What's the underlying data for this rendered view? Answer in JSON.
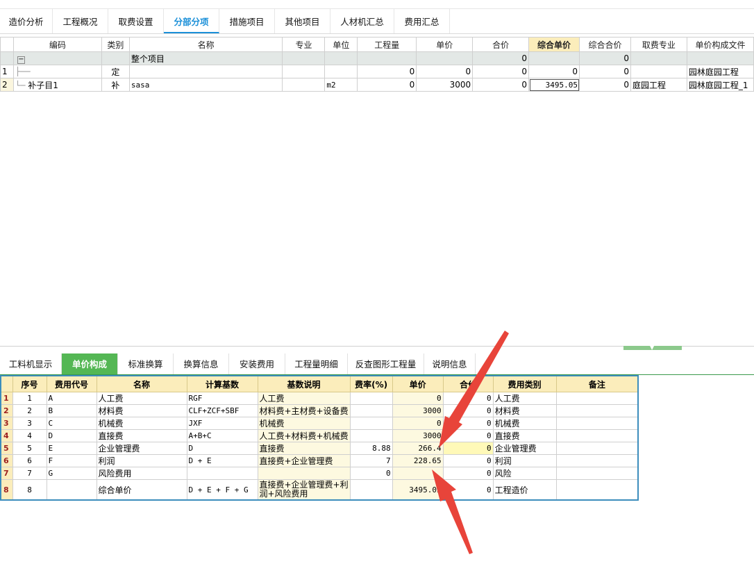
{
  "top_tabs": [
    "造价分析",
    "工程概况",
    "取费设置",
    "分部分项",
    "措施项目",
    "其他项目",
    "人材机汇总",
    "费用汇总"
  ],
  "active_top_tab": "分部分项",
  "main_grid": {
    "headers": [
      "编码",
      "类别",
      "名称",
      "专业",
      "单位",
      "工程量",
      "单价",
      "合价",
      "综合单价",
      "综合合价",
      "取费专业",
      "单价构成文件"
    ],
    "group_row": {
      "name": "整个项目",
      "total": "0",
      "composite_total": "0"
    },
    "rows": [
      {
        "row_no": "1",
        "code": "",
        "type": "定",
        "name": "",
        "major": "",
        "unit": "",
        "qty": "0",
        "price": "0",
        "total": "0",
        "comp_price": "0",
        "comp_total": "0",
        "fee_major": "",
        "file": "园林庭园工程"
      },
      {
        "row_no": "2",
        "code": "补子目1",
        "type": "补",
        "name": "sasa",
        "major": "",
        "unit": "m2",
        "qty": "0",
        "price": "3000",
        "total": "0",
        "comp_price": "3495.05",
        "comp_total": "0",
        "fee_major": "庭园工程",
        "file": "园林庭园工程_1"
      }
    ]
  },
  "bottom_tabs": [
    "工料机显示",
    "单价构成",
    "标准换算",
    "换算信息",
    "安装费用",
    "工程量明细",
    "反查图形工程量",
    "说明信息"
  ],
  "active_bottom_tab": "单价构成",
  "sub_grid": {
    "headers": [
      "序号",
      "费用代号",
      "名称",
      "计算基数",
      "基数说明",
      "费率(%)",
      "单价",
      "合价",
      "费用类别",
      "备注"
    ],
    "rows": [
      {
        "rn": "1",
        "seq": "1",
        "code": "A",
        "name": "人工费",
        "base": "RGF",
        "base_desc": "人工费",
        "rate": "",
        "price": "0",
        "total": "0",
        "category": "人工费",
        "note": ""
      },
      {
        "rn": "2",
        "seq": "2",
        "code": "B",
        "name": "材料费",
        "base": "CLF+ZCF+SBF",
        "base_desc": "材料费+主材费+设备费",
        "rate": "",
        "price": "3000",
        "total": "0",
        "category": "材料费",
        "note": ""
      },
      {
        "rn": "3",
        "seq": "3",
        "code": "C",
        "name": "机械费",
        "base": "JXF",
        "base_desc": "机械费",
        "rate": "",
        "price": "0",
        "total": "0",
        "category": "机械费",
        "note": ""
      },
      {
        "rn": "4",
        "seq": "4",
        "code": "D",
        "name": "直接费",
        "base": "A+B+C",
        "base_desc": "人工费+材料费+机械费",
        "rate": "",
        "price": "3000",
        "total": "0",
        "category": "直接费",
        "note": ""
      },
      {
        "rn": "5",
        "seq": "5",
        "code": "E",
        "name": "企业管理费",
        "base": "D",
        "base_desc": "直接费",
        "rate": "8.88",
        "price": "266.4",
        "total": "0",
        "category": "企业管理费",
        "note": ""
      },
      {
        "rn": "6",
        "seq": "6",
        "code": "F",
        "name": "利润",
        "base": "D + E",
        "base_desc": "直接费+企业管理费",
        "rate": "7",
        "price": "228.65",
        "total": "0",
        "category": "利润",
        "note": ""
      },
      {
        "rn": "7",
        "seq": "7",
        "code": "G",
        "name": "风险费用",
        "base": "",
        "base_desc": "",
        "rate": "0",
        "price": "",
        "total": "0",
        "category": "风险",
        "note": ""
      },
      {
        "rn": "8",
        "seq": "8",
        "code": "",
        "name": "综合单价",
        "base": "D + E + F + G",
        "base_desc": "直接费+企业管理费+利润+风险费用",
        "rate": "",
        "price": "3495.05",
        "total": "0",
        "category": "工程造价",
        "note": ""
      }
    ]
  },
  "colors": {
    "accent_blue": "#1a8fd8",
    "green_tab": "#54b754",
    "header_yellow": "#fbedbb",
    "arrow_red": "#e8443a"
  }
}
